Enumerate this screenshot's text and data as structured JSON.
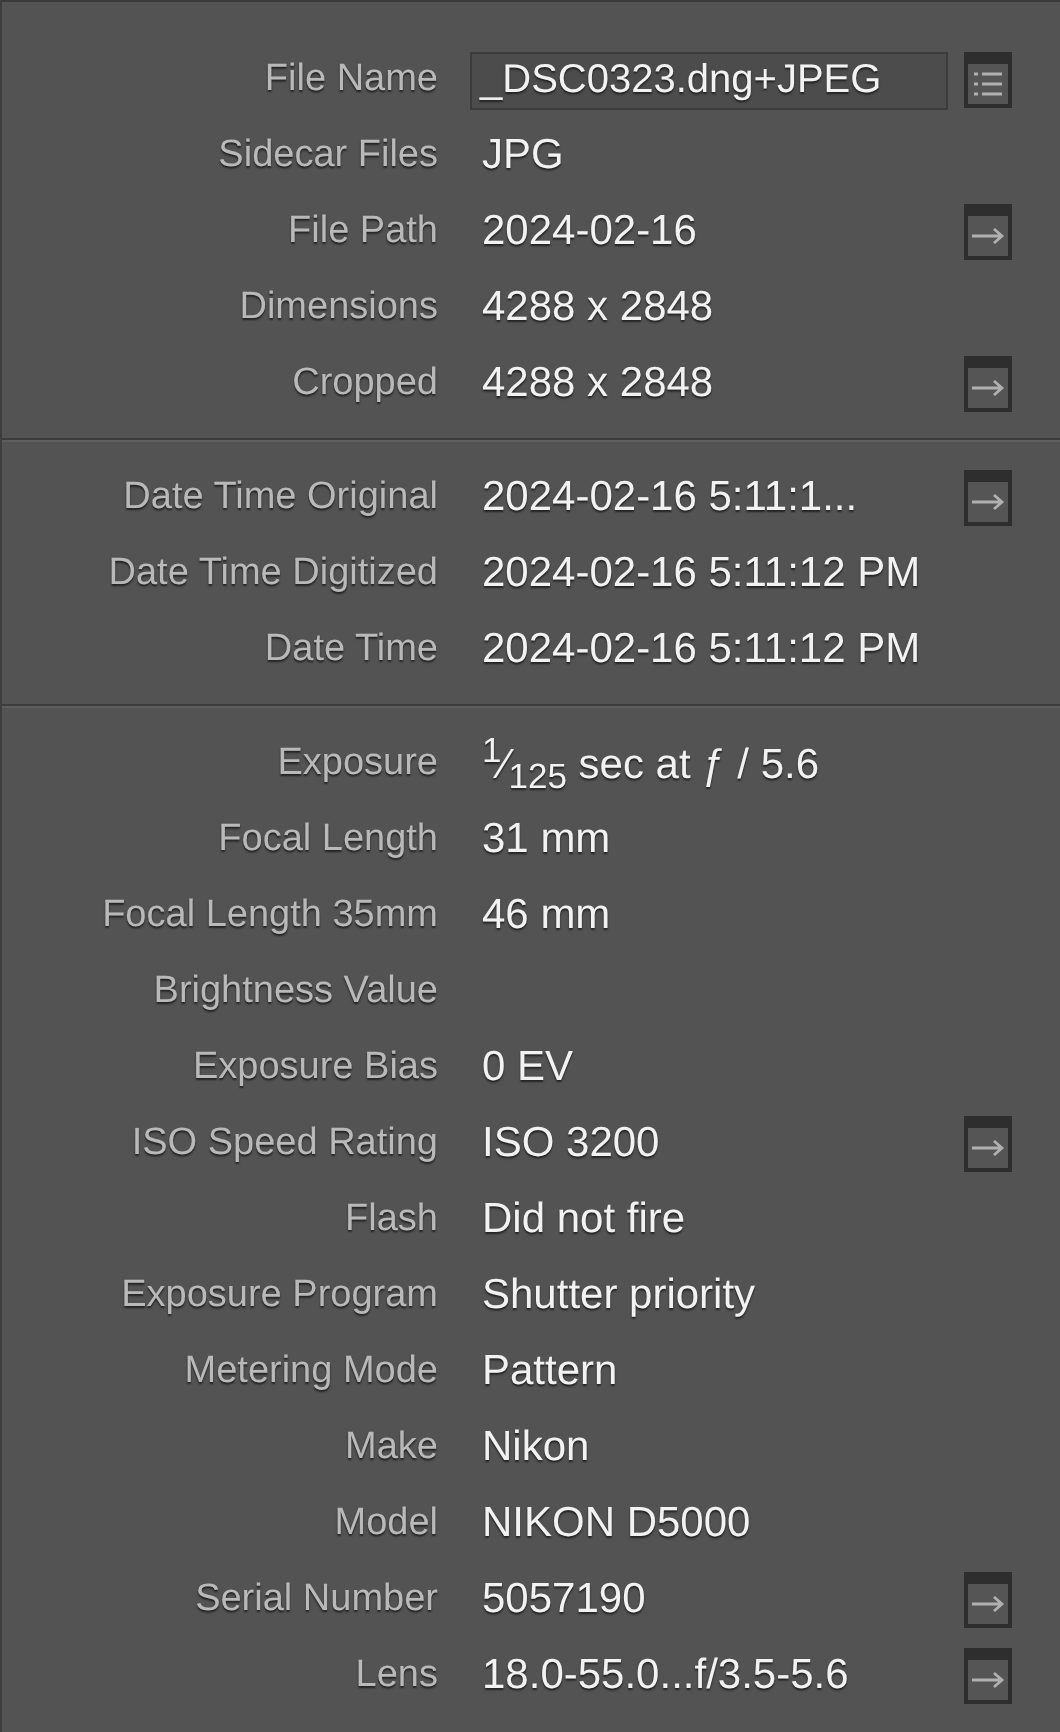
{
  "sections": [
    {
      "rows": [
        {
          "label": "File Name",
          "value": "_DSC0323.dng+JPEG",
          "kind": "field",
          "button": {
            "kind": "list"
          }
        },
        {
          "label": "Sidecar Files",
          "value": "JPG",
          "kind": "text"
        },
        {
          "label": "File Path",
          "value": "2024-02-16",
          "kind": "text",
          "button": {
            "kind": "goto"
          }
        },
        {
          "label": "Dimensions",
          "value": "4288 x 2848",
          "kind": "text"
        },
        {
          "label": "Cropped",
          "value": "4288 x 2848",
          "kind": "text",
          "button": {
            "kind": "goto"
          }
        }
      ]
    },
    {
      "rows": [
        {
          "label": "Date Time Original",
          "value": "2024-02-16 5:11:1...",
          "kind": "text",
          "button": {
            "kind": "goto"
          }
        },
        {
          "label": "Date Time Digitized",
          "value": "2024-02-16 5:11:12 PM",
          "kind": "text"
        },
        {
          "label": "Date Time",
          "value": "2024-02-16 5:11:12 PM",
          "kind": "text"
        }
      ]
    },
    {
      "rows": [
        {
          "label": "Exposure",
          "value": "$^{1}$⁄$_{125}$ sec at ƒ / 5.6",
          "kind": "text"
        },
        {
          "label": "Focal Length",
          "value": "31 mm",
          "kind": "text"
        },
        {
          "label": "Focal Length 35mm",
          "value": "46 mm",
          "kind": "text"
        },
        {
          "label": "Brightness Value",
          "kind": "text"
        },
        {
          "label": "Exposure Bias",
          "value": "0 EV",
          "kind": "text"
        },
        {
          "label": "ISO Speed Rating",
          "value": "ISO 3200",
          "kind": "text",
          "button": {
            "kind": "goto"
          }
        },
        {
          "label": "Flash",
          "value": "Did not fire",
          "kind": "text"
        },
        {
          "label": "Exposure Program",
          "value": "Shutter priority",
          "kind": "text"
        },
        {
          "label": "Metering Mode",
          "value": "Pattern",
          "kind": "text"
        },
        {
          "label": "Make",
          "value": "Nikon",
          "kind": "text"
        },
        {
          "label": "Model",
          "value": "NIKON D5000",
          "kind": "text"
        },
        {
          "label": "Serial Number",
          "value": "5057190",
          "kind": "text",
          "button": {
            "kind": "goto"
          }
        },
        {
          "label": "Lens",
          "value": "18.0-55.0...f/3.5-5.6",
          "kind": "text",
          "button": {
            "kind": "goto"
          }
        }
      ]
    }
  ]
}
